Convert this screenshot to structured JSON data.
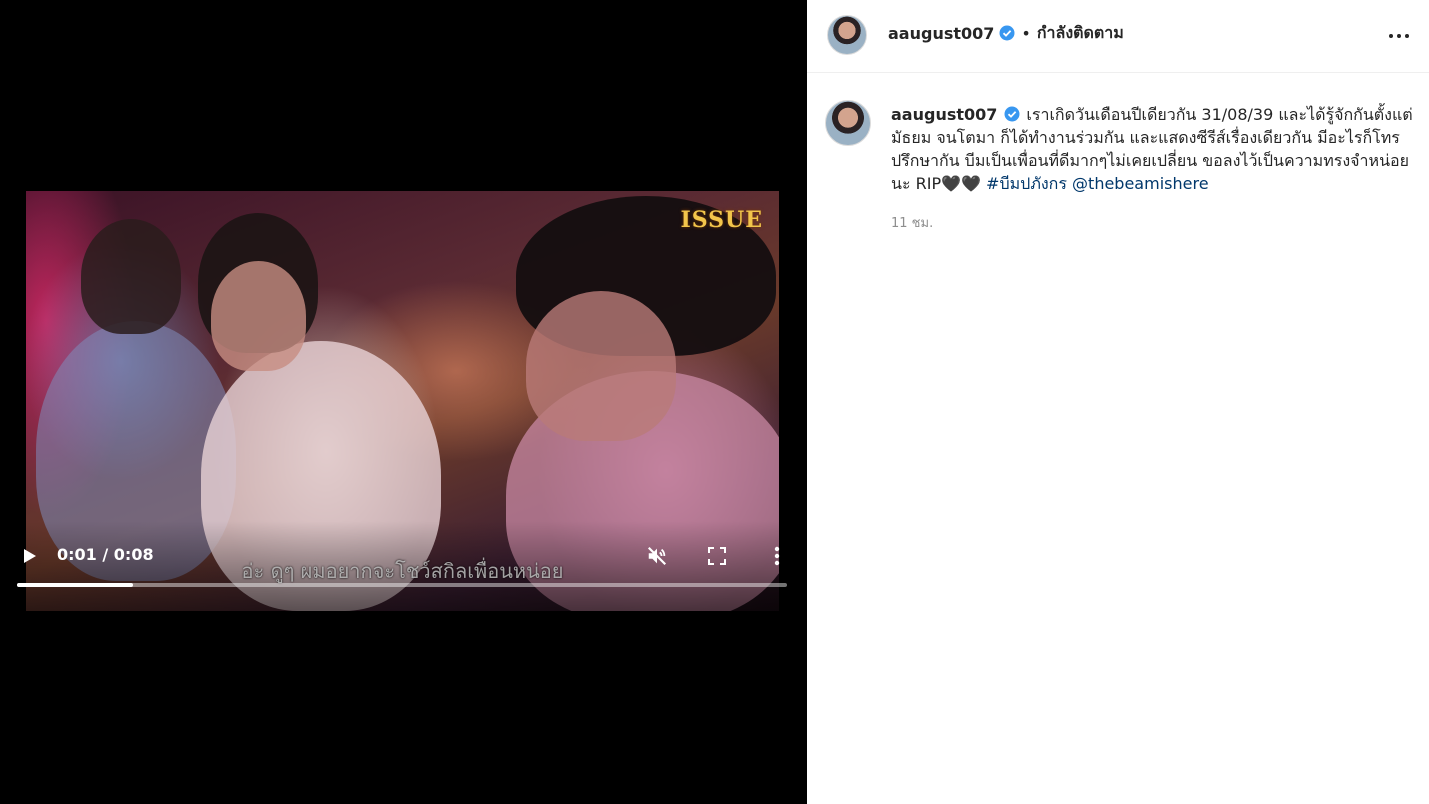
{
  "video": {
    "watermark": "ISSUE",
    "subtitle": "อ่ะ ดูๆ ผมอยากจะโชว์สกิลเพื่อนหน่อย",
    "time_current": "0:01",
    "time_separator": "/",
    "time_total": "0:08",
    "progress_fraction": 0.15,
    "icons": {
      "play": "play-icon",
      "mute": "volume-muted-icon",
      "fullscreen": "fullscreen-icon",
      "more": "more-vertical-icon"
    }
  },
  "post_header": {
    "username": "aaugust007",
    "separator": "•",
    "follow_status": "กำลังติดตาม",
    "options_icon": "more-horizontal-icon"
  },
  "caption": {
    "username": "aaugust007",
    "text": "เราเกิดวันเดือนปีเดียวกัน 31/08/39 และได้รู้จักกันตั้งแต่มัธยม จนโตมา ก็ได้ทำงานร่วมกัน และแสดงซีรีส์เรื่องเดียวกัน มีอะไรก็โทรปรึกษากัน บีมเป็นเพื่อนที่ดีมากๆไม่เคยเปลี่ยน ขอลงไว้เป็นความทรงจำหน่อยนะ RIP🖤🖤",
    "hashtag": "#บีมปภังกร",
    "mention": "@thebeamishere",
    "timestamp": "11 ชม."
  },
  "colors": {
    "verified_badge": "#3897f0",
    "link": "#00376b",
    "muted_text": "#8e8e8e"
  }
}
